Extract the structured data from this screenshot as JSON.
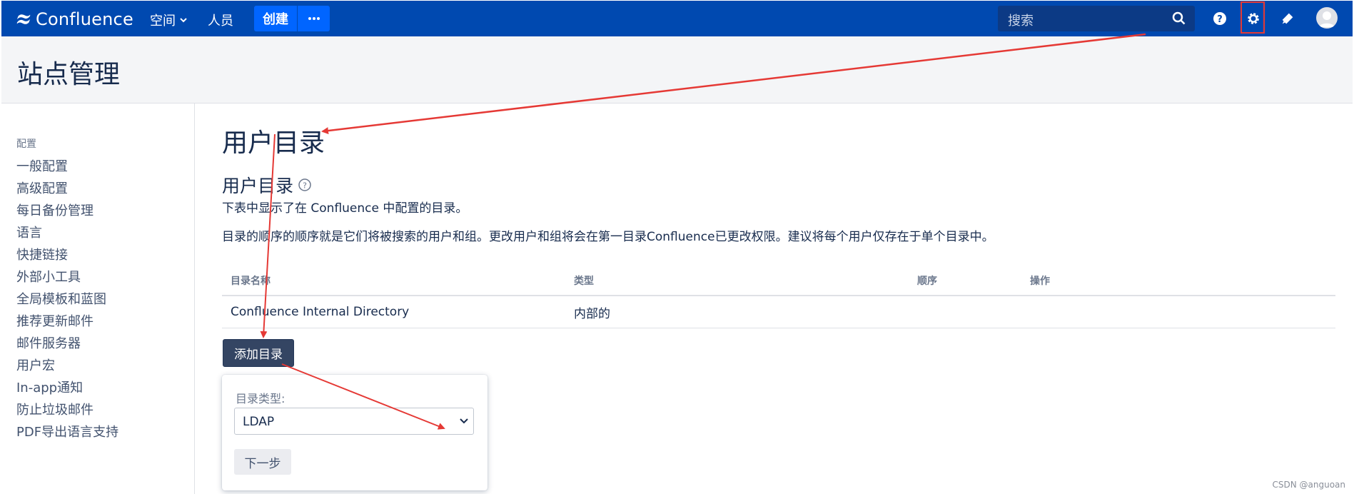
{
  "nav": {
    "logo_text": "Confluence",
    "spaces_label": "空间",
    "people_label": "人员",
    "create_label": "创建",
    "more_label": "···",
    "search_placeholder": "搜索"
  },
  "header": {
    "title": "站点管理"
  },
  "sidebar": {
    "heading": "配置",
    "items": [
      {
        "label": "一般配置"
      },
      {
        "label": "高级配置"
      },
      {
        "label": "每日备份管理"
      },
      {
        "label": "语言"
      },
      {
        "label": "快捷链接"
      },
      {
        "label": "外部小工具"
      },
      {
        "label": "全局模板和蓝图"
      },
      {
        "label": "推荐更新邮件"
      },
      {
        "label": "邮件服务器"
      },
      {
        "label": "用户宏"
      },
      {
        "label": "In-app通知"
      },
      {
        "label": "防止垃圾邮件"
      },
      {
        "label": "PDF导出语言支持"
      }
    ]
  },
  "main": {
    "title": "用户目录",
    "section_title": "用户目录",
    "desc1": "下表中显示了在 Confluence 中配置的目录。",
    "desc2": "目录的顺序的顺序就是它们将被搜索的用户和组。更改用户和组将会在第一目录Confluence已更改权限。建议将每个用户仅存在于单个目录中。",
    "table": {
      "headers": [
        "目录名称",
        "类型",
        "顺序",
        "操作"
      ],
      "rows": [
        {
          "name": "Confluence Internal Directory",
          "type": "内部的",
          "order": "",
          "actions": ""
        }
      ]
    },
    "add_button": "添加目录",
    "popup": {
      "label": "目录类型:",
      "selected": "LDAP",
      "next_button": "下一步"
    }
  },
  "watermark": "CSDN @anguoan",
  "colors": {
    "nav_bg": "#0049b0",
    "create_bg": "#0065ff",
    "add_button_bg": "#344563",
    "annotation": "#e53935"
  }
}
